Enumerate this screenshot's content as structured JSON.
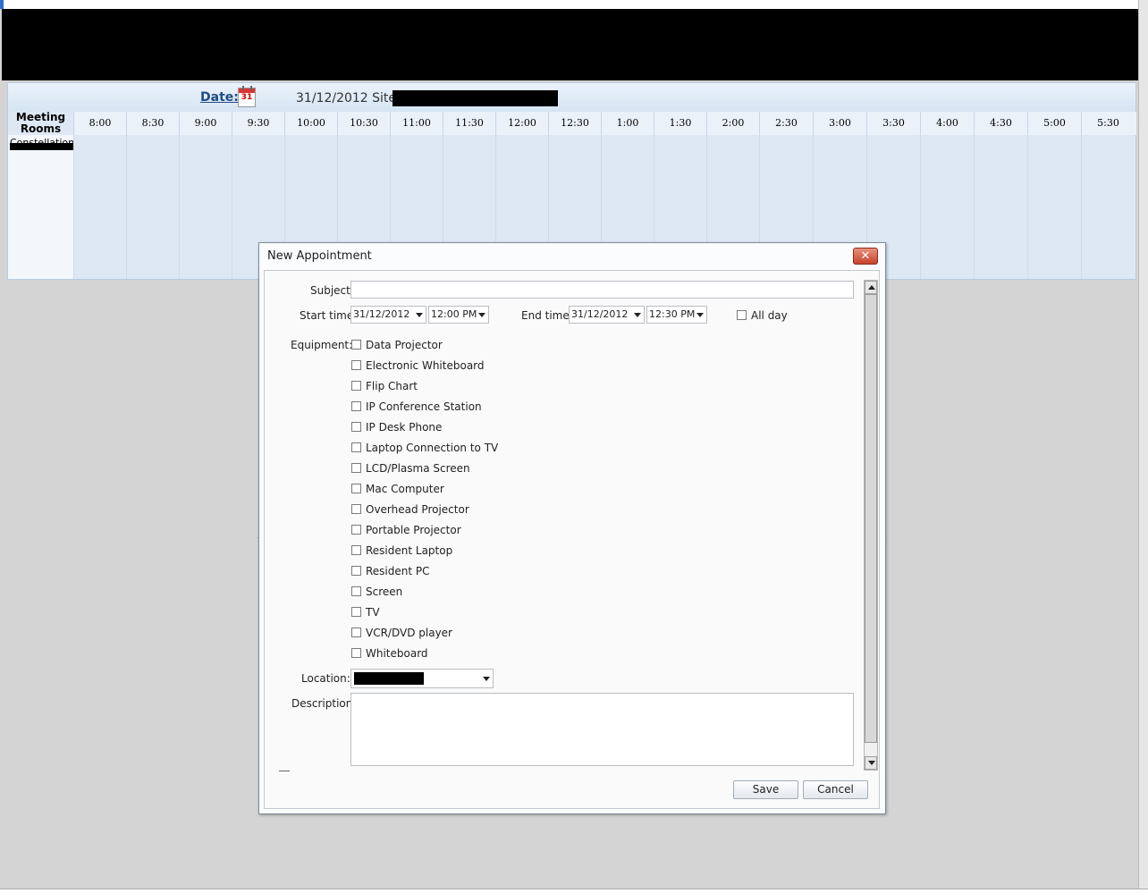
{
  "scheduler": {
    "date_label": "Date:",
    "calendar_icon": "calendar-icon",
    "calendar_day": "31",
    "date_value": "31/12/2012 Site:",
    "rooms_header": "Meeting Rooms",
    "room_name": "Constellation",
    "time_slots": [
      "8:00",
      "8:30",
      "9:00",
      "9:30",
      "10:00",
      "10:30",
      "11:00",
      "11:30",
      "12:00",
      "12:30",
      "1:00",
      "1:30",
      "2:00",
      "2:30",
      "3:00",
      "3:30",
      "4:00",
      "4:30",
      "5:00",
      "5:30"
    ]
  },
  "dialog": {
    "title": "New Appointment",
    "close_glyph": "✕",
    "subject_label": "Subject",
    "subject_value": "",
    "start_label": "Start time",
    "start_date": "31/12/2012",
    "start_time": "12:00 PM",
    "end_label": "End time",
    "end_date": "31/12/2012",
    "end_time": "12:30 PM",
    "allday_label": "All day",
    "equipment_label": "Equipment:",
    "equipment": [
      "Data Projector",
      "Electronic Whiteboard",
      "Flip Chart",
      "IP Conference Station",
      "IP Desk Phone",
      "Laptop Connection to TV",
      "LCD/Plasma Screen",
      "Mac Computer",
      "Overhead Projector",
      "Portable Projector",
      "Resident Laptop",
      "Resident PC",
      "Screen",
      "TV",
      "VCR/DVD player",
      "Whiteboard"
    ],
    "location_label": "Location:",
    "description_label": "Description",
    "description_value": "",
    "save_label": "Save",
    "cancel_label": "Cancel"
  },
  "colors": {
    "header_blue": "#1f4c86",
    "grid_fill": "#dde8f4",
    "close_red": "#c6452c"
  }
}
